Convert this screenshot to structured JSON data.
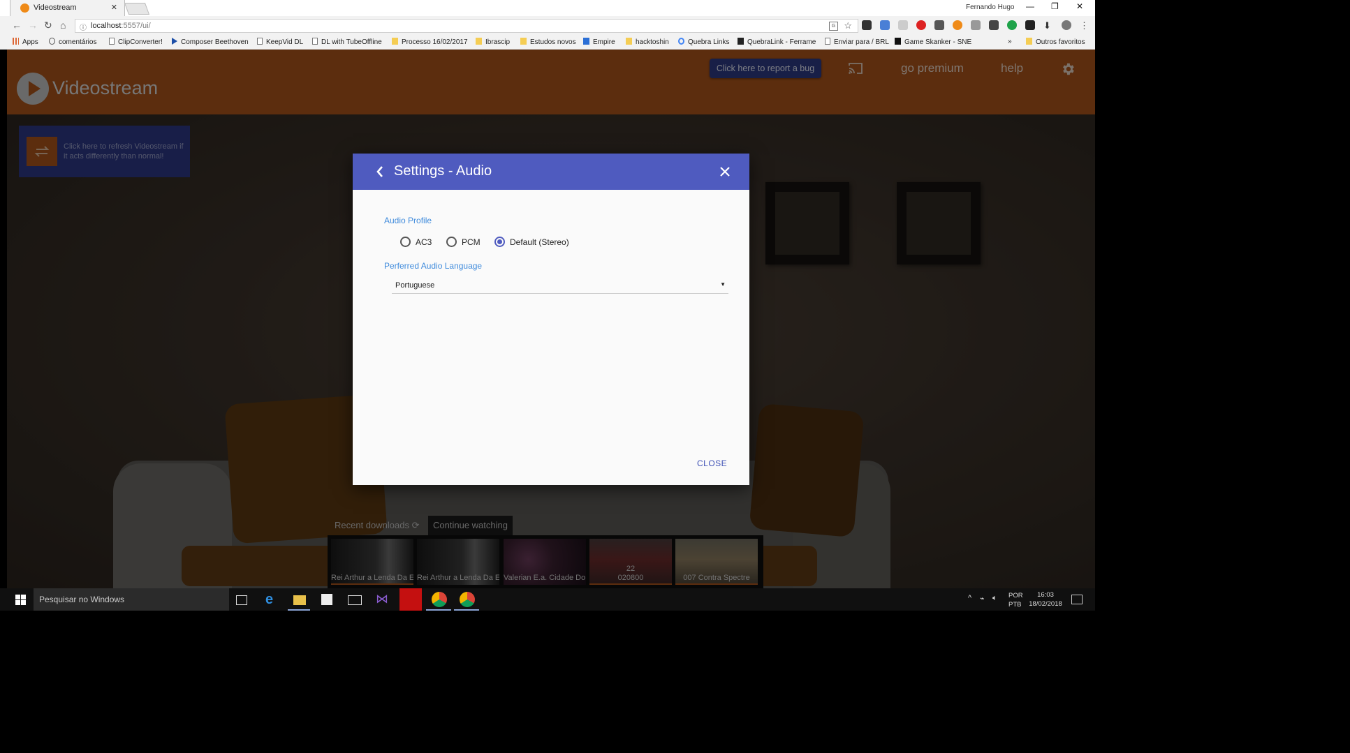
{
  "browser": {
    "tab_title": "Videostream",
    "profile_name": "Fernando Hugo",
    "url_host": "localhost",
    "url_path": ":5557/ui/",
    "bookmarks": [
      {
        "label": "Apps",
        "icon": "apps-grid-icon"
      },
      {
        "label": "comentários",
        "icon": "globe-icon"
      },
      {
        "label": "ClipConverter!",
        "icon": "page-icon"
      },
      {
        "label": "Composer Beethoven",
        "icon": "play-icon"
      },
      {
        "label": "KeepVid DL",
        "icon": "page-icon"
      },
      {
        "label": "DL with TubeOffline",
        "icon": "page-icon"
      },
      {
        "label": "Processo 16/02/2017",
        "icon": "folder-icon"
      },
      {
        "label": "Ibrascip",
        "icon": "folder-icon"
      },
      {
        "label": "Estudos novos",
        "icon": "folder-icon"
      },
      {
        "label": "Empire",
        "icon": "empire-icon"
      },
      {
        "label": "hacktoshin",
        "icon": "folder-icon"
      },
      {
        "label": "Quebra Links",
        "icon": "google-icon"
      },
      {
        "label": "QuebraLink - Ferrame",
        "icon": "lock-icon"
      },
      {
        "label": "Enviar para / BRL",
        "icon": "page-icon"
      },
      {
        "label": "Game Skanker - SNES",
        "icon": "game-icon"
      }
    ],
    "overflow": "»",
    "other_bookmarks": "Outros favoritos"
  },
  "app": {
    "logo_text": "Videostream",
    "bug_button": "Click here to report a bug",
    "go_premium": "go premium",
    "help": "help",
    "refresh_text": "Click here to refresh Videostream if it acts differently than normal!",
    "tab_recent": "Recent downloads",
    "tab_continue": "Continue watching",
    "thumbnails": [
      {
        "caption": "Rei Arthur a Lenda Da E...",
        "progress": 1.0
      },
      {
        "caption": "Rei Arthur a Lenda Da E...",
        "progress": 0
      },
      {
        "caption": "Valerian E.a. Cidade Do...",
        "progress": 0
      },
      {
        "caption_top": "22",
        "caption": "020800",
        "progress": 1.0
      },
      {
        "caption": "007 Contra Spectre",
        "progress": 1.0
      }
    ],
    "colors": {
      "header": "#a8531a",
      "dialog_header": "#4f5bbf",
      "accent_label": "#3f8bdc",
      "bug_button": "#2c3a82"
    }
  },
  "dialog": {
    "title": "Settings - Audio",
    "audio_profile_label": "Audio Profile",
    "options": [
      "AC3",
      "PCM",
      "Default (Stereo)"
    ],
    "selected_option": "Default (Stereo)",
    "language_label": "Perferred Audio Language",
    "language_value": "Portuguese",
    "close_button": "CLOSE"
  },
  "taskbar": {
    "search_placeholder": "Pesquisar no Windows",
    "lang_line1": "POR",
    "lang_line2": "PTB",
    "time": "16:03",
    "date": "18/02/2018"
  }
}
